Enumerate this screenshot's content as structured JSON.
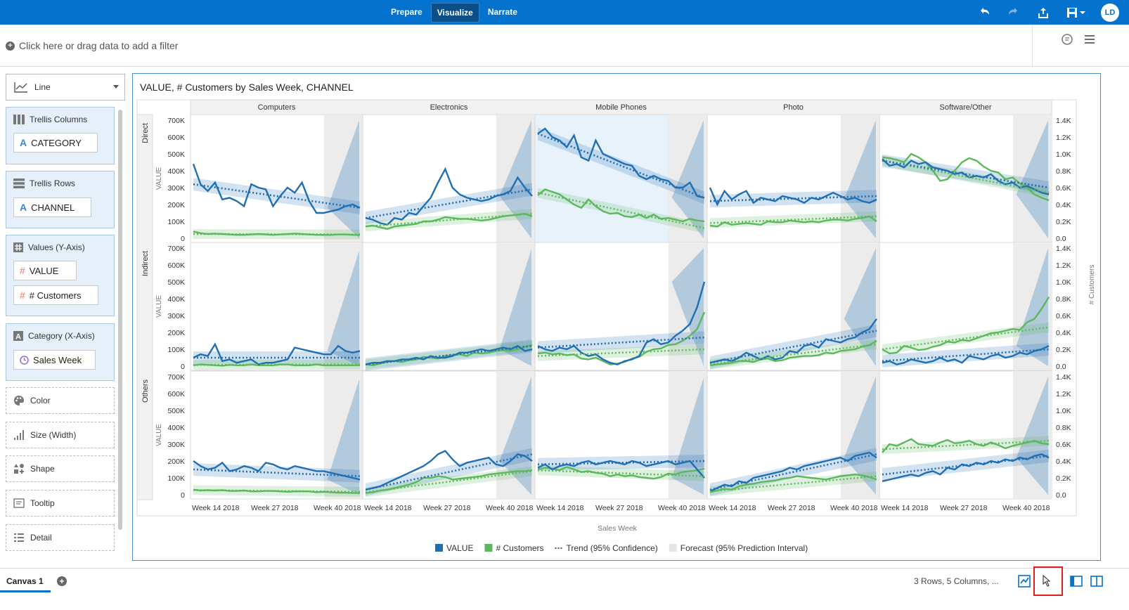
{
  "topbar": {
    "modes": [
      {
        "label": "Prepare",
        "active": false
      },
      {
        "label": "Visualize",
        "active": true
      },
      {
        "label": "Narrate",
        "active": false
      }
    ],
    "user_initials": "LD",
    "brand_color": "#0572ce"
  },
  "filterbar": {
    "placeholder": "Click here or drag data to add a filter"
  },
  "left_panel": {
    "chart_type": "Line",
    "trellis_columns": {
      "label": "Trellis Columns",
      "items": [
        "CATEGORY"
      ]
    },
    "trellis_rows": {
      "label": "Trellis Rows",
      "items": [
        "CHANNEL"
      ]
    },
    "values": {
      "label": "Values (Y-Axis)",
      "items": [
        "VALUE",
        "# Customers"
      ]
    },
    "category": {
      "label": "Category (X-Axis)",
      "items": [
        "Sales Week"
      ]
    },
    "color": "Color",
    "size": "Size (Width)",
    "shape": "Shape",
    "tooltip": "Tooltip",
    "detail": "Detail"
  },
  "chart": {
    "title": "VALUE, # Customers by Sales Week, CHANNEL",
    "x_axis_title": "Sales Week",
    "left_axis_title": "VALUE",
    "right_axis_title": "# Customers",
    "legend": [
      {
        "label": "VALUE",
        "color": "#1f6fb2",
        "icon": "square"
      },
      {
        "label": "# Customers",
        "color": "#5cb85c",
        "icon": "square"
      },
      {
        "label": "Trend (95% Confidence)",
        "color": "#555555",
        "icon": "dotted-line"
      },
      {
        "label": "Forecast (95% Prediction Interval)",
        "color": "#e6e6e6",
        "icon": "square"
      }
    ]
  },
  "chart_data": {
    "type": "line",
    "columns": [
      "Computers",
      "Electronics",
      "Mobile Phones",
      "Photo",
      "Software/Other"
    ],
    "rows": [
      "Direct",
      "Indirect",
      "Others"
    ],
    "x_ticks": [
      "Week 14 2018",
      "Week 27 2018",
      "Week 40 2018"
    ],
    "y_left_ticks": [
      "700K",
      "600K",
      "500K",
      "400K",
      "300K",
      "200K",
      "100K",
      "0"
    ],
    "y_right_ticks": [
      "1.4K",
      "1.2K",
      "1.0K",
      "0.8K",
      "0.6K",
      "0.4K",
      "0.2K",
      "0.0"
    ],
    "y_left_range": [
      0,
      700000
    ],
    "y_right_range": [
      0,
      1400
    ],
    "value_color": "#1f6fb2",
    "customers_color": "#5cb85c",
    "highlighted_cell": {
      "row": "Direct",
      "column": "Mobile Phones"
    },
    "panels": [
      [
        {
          "value": [
            440,
            320,
            280,
            330,
            230,
            240,
            220,
            190,
            320,
            300,
            290,
            190,
            250,
            300,
            270,
            330,
            220,
            150,
            150,
            160,
            170,
            190,
            200,
            180
          ],
          "customers": [
            80,
            60,
            50,
            55,
            50,
            45,
            40,
            40,
            45,
            50,
            45,
            40,
            45,
            50,
            55,
            50,
            45,
            40,
            40,
            40,
            45,
            45,
            40,
            38
          ],
          "value_trend": [
            320,
            180
          ],
          "customers_trend": [
            50,
            45
          ]
        },
        {
          "value": [
            120,
            110,
            90,
            80,
            120,
            110,
            150,
            140,
            190,
            240,
            330,
            410,
            300,
            260,
            240,
            230,
            220,
            230,
            250,
            260,
            280,
            360,
            300,
            250
          ],
          "customers": [
            140,
            150,
            130,
            110,
            140,
            150,
            160,
            170,
            200,
            200,
            220,
            250,
            240,
            230,
            230,
            220,
            210,
            220,
            240,
            260,
            270,
            280,
            290,
            260
          ],
          "value_trend": [
            120,
            290
          ],
          "customers_trend": [
            140,
            290
          ]
        },
        {
          "value": [
            620,
            650,
            600,
            580,
            540,
            610,
            480,
            460,
            580,
            500,
            480,
            460,
            440,
            430,
            370,
            350,
            370,
            350,
            340,
            300,
            300,
            330,
            250,
            240
          ],
          "customers": [
            510,
            580,
            550,
            520,
            460,
            400,
            360,
            460,
            380,
            320,
            290,
            300,
            260,
            250,
            280,
            240,
            280,
            230,
            240,
            220,
            200,
            230,
            210,
            200
          ],
          "value_trend": [
            620,
            240
          ],
          "customers_trend": [
            540,
            120
          ]
        },
        {
          "value": [
            300,
            200,
            280,
            230,
            260,
            280,
            210,
            240,
            230,
            220,
            250,
            240,
            230,
            210,
            240,
            230,
            250,
            270,
            250,
            230,
            240,
            220,
            210,
            230
          ],
          "customers": [
            150,
            140,
            190,
            160,
            170,
            180,
            170,
            160,
            200,
            190,
            190,
            210,
            200,
            190,
            200,
            190,
            210,
            220,
            220,
            210,
            230,
            240,
            260,
            200
          ],
          "value_trend": [
            220,
            250
          ],
          "customers_trend": [
            180,
            260
          ]
        },
        {
          "value": [
            470,
            430,
            440,
            420,
            460,
            440,
            450,
            420,
            410,
            400,
            380,
            390,
            360,
            370,
            360,
            380,
            340,
            320,
            330,
            300,
            310,
            290,
            270,
            260
          ],
          "customers": [
            960,
            950,
            930,
            900,
            1000,
            960,
            900,
            800,
            680,
            700,
            800,
            900,
            950,
            920,
            850,
            800,
            780,
            700,
            720,
            650,
            600,
            520,
            480,
            450
          ],
          "value_trend": [
            460,
            300
          ],
          "customers_trend": [
            920,
            540
          ]
        }
      ],
      [
        {
          "value": [
            50,
            70,
            60,
            130,
            30,
            40,
            20,
            30,
            40,
            10,
            20,
            20,
            30,
            40,
            110,
            100,
            90,
            80,
            70,
            70,
            120,
            90,
            80,
            90
          ],
          "customers": [
            10,
            20,
            15,
            10,
            5,
            15,
            10,
            10,
            20,
            10,
            10,
            10,
            20,
            20,
            10,
            10,
            10,
            20,
            10,
            10,
            10,
            10,
            10,
            10
          ],
          "value_trend": [
            50,
            50
          ],
          "customers_trend": [
            15,
            20
          ]
        },
        {
          "value": [
            10,
            20,
            20,
            30,
            30,
            40,
            40,
            50,
            40,
            60,
            50,
            50,
            60,
            80,
            80,
            90,
            100,
            90,
            100,
            110,
            100,
            120,
            90,
            100
          ],
          "customers": [
            20,
            10,
            30,
            50,
            60,
            50,
            70,
            80,
            110,
            100,
            90,
            120,
            130,
            140,
            120,
            160,
            150,
            160,
            180,
            190,
            180,
            200,
            230,
            250
          ],
          "value_trend": [
            10,
            120
          ],
          "customers_trend": [
            20,
            240
          ]
        },
        {
          "value": [
            120,
            100,
            90,
            110,
            100,
            120,
            80,
            60,
            70,
            40,
            20,
            10,
            30,
            40,
            60,
            140,
            160,
            130,
            140,
            180,
            210,
            250,
            350,
            500
          ],
          "customers": [
            150,
            160,
            140,
            150,
            130,
            140,
            90,
            80,
            100,
            60,
            20,
            30,
            50,
            90,
            110,
            170,
            200,
            210,
            250,
            260,
            300,
            360,
            440,
            640
          ],
          "value_trend": [
            110,
            170
          ],
          "customers_trend": [
            120,
            200
          ]
        },
        {
          "value": [
            20,
            30,
            40,
            30,
            50,
            80,
            60,
            40,
            60,
            40,
            50,
            90,
            80,
            120,
            130,
            110,
            160,
            150,
            140,
            160,
            170,
            200,
            220,
            280
          ],
          "customers": [
            10,
            20,
            30,
            40,
            60,
            60,
            50,
            80,
            90,
            60,
            70,
            100,
            110,
            120,
            120,
            130,
            160,
            150,
            180,
            190,
            200,
            230,
            250,
            300
          ],
          "value_trend": [
            20,
            210
          ],
          "customers_trend": [
            20,
            260
          ]
        },
        {
          "value": [
            20,
            30,
            10,
            20,
            40,
            30,
            20,
            30,
            50,
            30,
            40,
            20,
            60,
            50,
            40,
            60,
            70,
            50,
            60,
            80,
            70,
            90,
            100,
            120
          ],
          "customers": [
            200,
            150,
            160,
            240,
            220,
            190,
            200,
            230,
            250,
            290,
            280,
            310,
            300,
            330,
            360,
            390,
            400,
            420,
            440,
            430,
            520,
            560,
            680,
            820
          ],
          "value_trend": [
            30,
            100
          ],
          "customers_trend": [
            200,
            460
          ]
        }
      ],
      [
        {
          "value": [
            200,
            170,
            150,
            160,
            190,
            140,
            150,
            170,
            160,
            140,
            190,
            180,
            160,
            150,
            170,
            160,
            150,
            140,
            140,
            130,
            120,
            110,
            100,
            90
          ],
          "customers": [
            60,
            50,
            55,
            50,
            55,
            45,
            45,
            50,
            40,
            40,
            45,
            45,
            40,
            35,
            40,
            40,
            40,
            30,
            35,
            30,
            25,
            25,
            20,
            20
          ],
          "value_trend": [
            150,
            110
          ],
          "customers_trend": [
            55,
            35
          ]
        },
        {
          "value": [
            30,
            40,
            50,
            70,
            90,
            110,
            130,
            150,
            170,
            200,
            240,
            260,
            210,
            170,
            190,
            200,
            210,
            220,
            180,
            170,
            200,
            240,
            230,
            200
          ],
          "customers": [
            20,
            30,
            50,
            60,
            80,
            100,
            120,
            150,
            200,
            200,
            220,
            210,
            180,
            190,
            200,
            210,
            220,
            240,
            250,
            260,
            270,
            280,
            280,
            290
          ],
          "value_trend": [
            30,
            240
          ],
          "customers_trend": [
            30,
            280
          ]
        },
        {
          "value": [
            160,
            180,
            150,
            170,
            180,
            170,
            190,
            200,
            180,
            190,
            200,
            190,
            180,
            200,
            190,
            170,
            180,
            190,
            200,
            180,
            190,
            200,
            150,
            100
          ],
          "customers": [
            300,
            320,
            310,
            290,
            330,
            300,
            270,
            280,
            260,
            250,
            220,
            240,
            220,
            230,
            210,
            200,
            190,
            210,
            250,
            240,
            270,
            280,
            290,
            310
          ],
          "value_trend": [
            180,
            200
          ],
          "customers_trend": [
            290,
            220
          ]
        },
        {
          "value": [
            20,
            40,
            60,
            50,
            80,
            70,
            100,
            110,
            120,
            130,
            140,
            160,
            150,
            170,
            180,
            190,
            200,
            210,
            220,
            200,
            230,
            240,
            250,
            220
          ],
          "customers": [
            30,
            50,
            70,
            60,
            100,
            120,
            130,
            150,
            160,
            170,
            190,
            200,
            220,
            210,
            200,
            190,
            180,
            200,
            220,
            230,
            240,
            230,
            210,
            180
          ],
          "value_trend": [
            30,
            240
          ],
          "customers_trend": [
            40,
            220
          ]
        },
        {
          "value": [
            80,
            90,
            100,
            110,
            120,
            110,
            130,
            140,
            120,
            160,
            150,
            180,
            170,
            190,
            180,
            200,
            190,
            210,
            200,
            220,
            210,
            230,
            240,
            220
          ],
          "customers": [
            500,
            600,
            580,
            620,
            660,
            600,
            590,
            580,
            620,
            650,
            610,
            620,
            640,
            600,
            580,
            620,
            590,
            550,
            580,
            600,
            620,
            640,
            610,
            600
          ],
          "value_trend": [
            120,
            230
          ],
          "customers_trend": [
            540,
            640
          ]
        }
      ]
    ]
  },
  "bottombar": {
    "canvas_name": "Canvas 1",
    "status": "3 Rows, 5 Columns, ..."
  }
}
